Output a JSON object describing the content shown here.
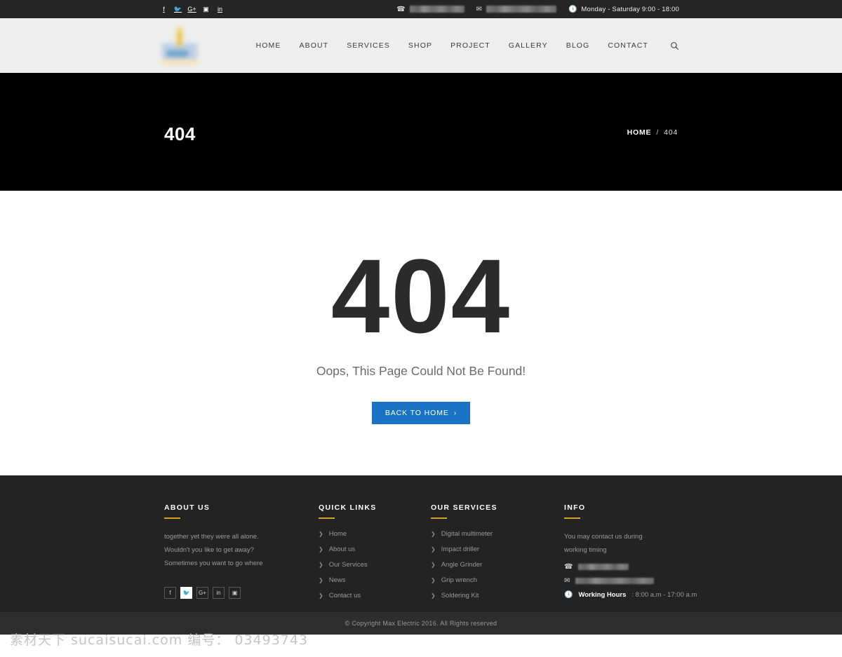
{
  "topbar": {
    "socials": [
      {
        "name": "facebook-icon",
        "glyph": "f"
      },
      {
        "name": "twitter-icon",
        "glyph": "🐦"
      },
      {
        "name": "google-plus-icon",
        "glyph": "G+"
      },
      {
        "name": "instagram-icon",
        "glyph": "▣"
      },
      {
        "name": "linkedin-icon",
        "glyph": "in"
      }
    ],
    "phone_icon": "☎",
    "phone_value": "",
    "email_icon": "✉",
    "email_value": "",
    "clock_icon": "ὕ4",
    "hours": "Monday - Saturday 9:00 - 18:00"
  },
  "header": {
    "logo_alt": "Max Electric logo",
    "nav": [
      {
        "label": "HOME"
      },
      {
        "label": "ABOUT"
      },
      {
        "label": "SERVICES"
      },
      {
        "label": "SHOP"
      },
      {
        "label": "PROJECT"
      },
      {
        "label": "GALLERY"
      },
      {
        "label": "BLOG"
      },
      {
        "label": "CONTACT"
      }
    ],
    "search_icon": "search-icon"
  },
  "banner": {
    "title": "404",
    "breadcrumb_home": "HOME",
    "breadcrumb_sep": "/",
    "breadcrumb_current": "404"
  },
  "content": {
    "code": "404",
    "message": "Oops, This Page Could Not Be Found!",
    "button_label": "BACK TO HOME",
    "button_arrow": "›",
    "button_color": "#1a72c4"
  },
  "footer": {
    "accent_color": "#d9a227",
    "about": {
      "heading": "ABOUT US",
      "lines": [
        "together yet they were all alone.",
        "Wouldn't you like to get away?",
        "Sometimes you want to go where"
      ],
      "socials": [
        {
          "name": "facebook-icon",
          "glyph": "f",
          "active": false
        },
        {
          "name": "twitter-icon",
          "glyph": "🐦",
          "active": true
        },
        {
          "name": "google-plus-icon",
          "glyph": "G+",
          "active": false
        },
        {
          "name": "linkedin-icon",
          "glyph": "in",
          "active": false
        },
        {
          "name": "instagram-icon",
          "glyph": "▣",
          "active": false
        }
      ]
    },
    "quick_links": {
      "heading": "QUICK LINKS",
      "items": [
        {
          "label": "Home"
        },
        {
          "label": "About us"
        },
        {
          "label": "Our Services"
        },
        {
          "label": "News"
        },
        {
          "label": "Contact us"
        }
      ]
    },
    "services": {
      "heading": "OUR SERVICES",
      "items": [
        {
          "label": "Digital multimeter"
        },
        {
          "label": "Impact driller"
        },
        {
          "label": "Angle Grinder"
        },
        {
          "label": "Grip wrench"
        },
        {
          "label": "Soldering Kit"
        }
      ]
    },
    "info": {
      "heading": "INFO",
      "line1": "You may contact us during",
      "line2": "working timing",
      "phone_value": "",
      "email_value": "",
      "working_hours_label": "Working Hours",
      "working_hours_value": ": 8:00 a.m - 17:00 a.m"
    },
    "copyright": "© Copyright Max Electric 2016. All Rights reserved"
  },
  "watermark": {
    "text": "素材天下 sucaisucai.com  编号： 03493743"
  }
}
